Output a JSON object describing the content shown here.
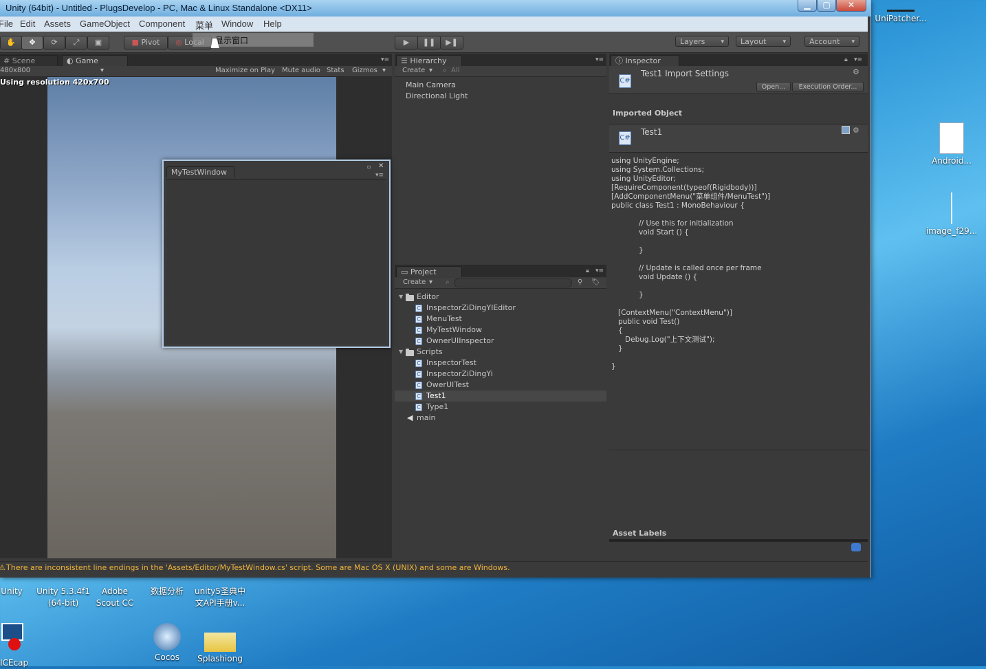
{
  "window": {
    "title": "Unity (64bit) - Untitled - PlugsDevelop - PC, Mac & Linux Standalone <DX11>",
    "minimize": "▁",
    "maximize": "▢",
    "close": "✕"
  },
  "menu": [
    "File",
    "Edit",
    "Assets",
    "GameObject",
    "Component",
    "菜单",
    "Window",
    "Help"
  ],
  "toolbar": {
    "pivot": "Pivot",
    "local": "Local",
    "tooltip": "显示窗口",
    "play": "▶",
    "pause": "❚❚",
    "step": "▶❚",
    "layers": "Layers",
    "layout": "Layout",
    "account": "Account"
  },
  "scene_game": {
    "tab_scene": "Scene",
    "tab_game": "Game",
    "aspect": "480x800",
    "maximize_on_play": "Maximize on Play",
    "mute_audio": "Mute audio",
    "stats": "Stats",
    "gizmos": "Gizmos",
    "resolution_text": "Using resolution 420x700"
  },
  "floating_window": {
    "tab": "MyTestWindow"
  },
  "hierarchy": {
    "tab": "Hierarchy",
    "create": "Create",
    "search_placeholder": "All",
    "items": [
      "Main Camera",
      "Directional Light"
    ]
  },
  "project": {
    "tab": "Project",
    "create": "Create",
    "editor_folder": "Editor",
    "editor_items": [
      "InspectorZiDingYIEditor",
      "MenuTest",
      "MyTestWindow",
      "OwnerUIInspector"
    ],
    "scripts_folder": "Scripts",
    "scripts_items": [
      "InspectorTest",
      "InspectorZiDingYi",
      "OwerUITest",
      "Test1",
      "Type1"
    ],
    "scene_item": "main"
  },
  "inspector": {
    "tab": "Inspector",
    "import_title": "Test1 Import Settings",
    "open_button": "Open...",
    "execution_order_button": "Execution Order...",
    "imported_object_header": "Imported Object",
    "object_name": "Test1",
    "code": "using UnityEngine;\nusing System.Collections;\nusing UnityEditor;\n[RequireComponent(typeof(Rigidbody))]\n[AddComponentMenu(\"菜单组件/MenuTest\")]\npublic class Test1 : MonoBehaviour {\n\n            // Use this for initialization\n            void Start () {\n\n            }\n\n            // Update is called once per frame\n            void Update () {\n\n            }\n\n   [ContextMenu(\"ContextMenu\")]\n   public void Test()\n   {\n      Debug.Log(\"上下文测试\");\n   }\n\n}",
    "asset_labels": "Asset Labels"
  },
  "status_bar": {
    "warning": "There are inconsistent line endings in the 'Assets/Editor/MyTestWindow.cs' script. Some are Mac OS X (UNIX) and some are Windows."
  },
  "desktop": {
    "right_icons": [
      "UniPatcher...",
      "Android...",
      "image_f29..."
    ],
    "bottom_icons": [
      "Unity",
      "Unity 5.3.4f1\n(64-bit)",
      "Adobe\nScout CC",
      "数据分析",
      "unity5圣典中\n文API手册v...",
      "ICEcap",
      "Cocos",
      "Splashiong"
    ]
  },
  "colors": {
    "warning": "#f2b53a",
    "selection": "#474747",
    "accent": "#3f7ad1"
  }
}
